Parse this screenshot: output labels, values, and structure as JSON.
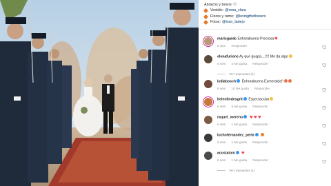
{
  "caption": {
    "greeting": "Abrazos y besos 🤍",
    "credits": [
      {
        "label": "Vestido:",
        "handle": "@rosa_clara"
      },
      {
        "label": "Flores y ramo:",
        "handle": "@lovingtheflowers"
      },
      {
        "label": "Fotos:",
        "handle": "@ivan_ladejo"
      }
    ]
  },
  "comments": [
    {
      "username": "marisgarab",
      "verified": false,
      "text": "Enhorabuena Preciosa",
      "emoji": "red-heart",
      "time": "6 sem",
      "likes": "",
      "reply": "Responder",
      "avatar_color": "#b89a7a",
      "ring": true
    },
    {
      "username": "elenafurione",
      "verified": false,
      "text": "Ay que guapa....!!!! Me da algo",
      "emoji": "heart-eyes",
      "time": "6 sem",
      "likes": "4 Me gusta",
      "reply": "Responder",
      "avatar_color": "#5b4a3a",
      "ring": false,
      "replies_label": "Ver respuestas (1)"
    },
    {
      "username": "lydiabosch",
      "verified": true,
      "text": "Enhorabuena Esmeralda!!",
      "emoji": "flowers",
      "time": "6 sem",
      "likes": "10 Me gusta",
      "reply": "Responder",
      "avatar_color": "#6e4b3c",
      "ring": false
    },
    {
      "username": "helenlindesgrit",
      "verified": true,
      "text": "Espectacular",
      "emoji": "heart-eyes",
      "time": "6 sem",
      "likes": "5 Me gusta",
      "reply": "Responder",
      "avatar_color": "#c47a3a",
      "ring": true
    },
    {
      "username": "raquel_mereno",
      "verified": true,
      "text": "",
      "emoji": "three-hearts",
      "time": "6 sem",
      "likes": "1 Me gusta",
      "reply": "Responder",
      "avatar_color": "#7b5a44",
      "ring": false
    },
    {
      "username": "luchofernandez_perla",
      "verified": true,
      "text": "",
      "emoji": "fire",
      "time": "6 sem",
      "likes": "1 Me gusta",
      "reply": "Responder",
      "avatar_color": "#3a3a3a",
      "ring": false
    },
    {
      "username": "acostaloni",
      "verified": true,
      "text": "",
      "emoji": "red-heart",
      "time": "6 sem",
      "likes": "1 Me gusta",
      "reply": "Responder",
      "avatar_color": "#4a4a4a",
      "ring": false,
      "replies_label": "Ver respuestas (1)"
    }
  ],
  "colors": {
    "link": "#00376b",
    "muted": "#8e8e8e",
    "verified": "#3897f0",
    "heart": "#ed4956"
  }
}
